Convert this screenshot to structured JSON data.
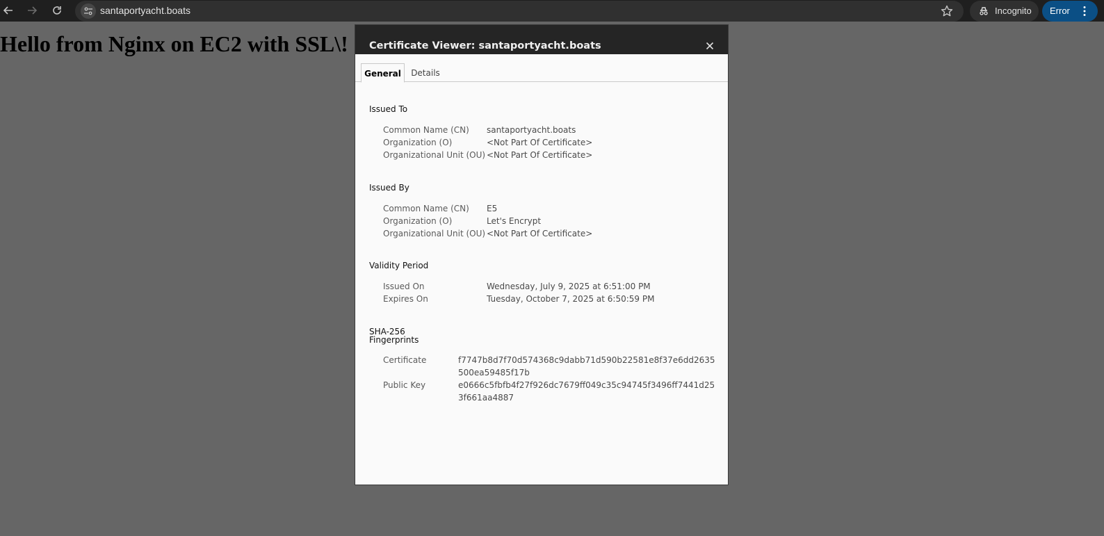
{
  "browser": {
    "url": "santaportyacht.boats",
    "profile_label": "Incognito",
    "error_label": "Error"
  },
  "page": {
    "heading": "Hello from Nginx on EC2 with SSL\\!"
  },
  "dialog": {
    "title": "Certificate Viewer: santaportyacht.boats",
    "tabs": [
      {
        "label": "General",
        "active": true
      },
      {
        "label": "Details",
        "active": false
      }
    ],
    "issued_to": {
      "title": "Issued To",
      "rows": [
        {
          "label": "Common Name (CN)",
          "value": "santaportyacht.boats"
        },
        {
          "label": "Organization (O)",
          "value": "<Not Part Of Certificate>"
        },
        {
          "label": "Organizational Unit (OU)",
          "value": "<Not Part Of Certificate>"
        }
      ]
    },
    "issued_by": {
      "title": "Issued By",
      "rows": [
        {
          "label": "Common Name (CN)",
          "value": "E5"
        },
        {
          "label": "Organization (O)",
          "value": "Let's Encrypt"
        },
        {
          "label": "Organizational Unit (OU)",
          "value": "<Not Part Of Certificate>"
        }
      ]
    },
    "validity": {
      "title": "Validity Period",
      "rows": [
        {
          "label": "Issued On",
          "value": "Wednesday, July 9, 2025 at 6:51:00 PM"
        },
        {
          "label": "Expires On",
          "value": "Tuesday, October 7, 2025 at 6:50:59 PM"
        }
      ]
    },
    "fingerprints": {
      "title_line1": "SHA-256",
      "title_line2": "Fingerprints",
      "rows": [
        {
          "label": "Certificate",
          "value": "f7747b8d7f70d574368c9dabb71d590b22581e8f37e6dd2635500ea59485f17b"
        },
        {
          "label": "Public Key",
          "value": "e0666c5fbfb4f27f926dc7679ff049c35c94745f3496ff7441d253f661aa4887"
        }
      ]
    }
  },
  "colors": {
    "toolbar_bg": "#1f1f1f",
    "omnibox_bg": "#303030",
    "page_backdrop": "#666666",
    "error_chip": "#0b4f85",
    "dialog_header": "#252525"
  }
}
